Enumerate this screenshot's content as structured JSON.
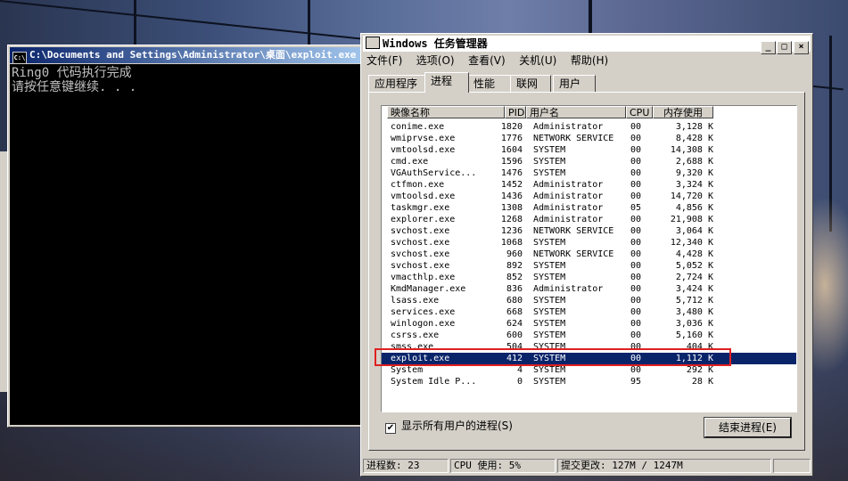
{
  "console": {
    "title": "C:\\Documents and Settings\\Administrator\\桌面\\exploit.exe",
    "icon": "console-icon",
    "lines": [
      "Ring0 代码执行完成",
      "请按任意键继续. . ."
    ]
  },
  "taskmgr": {
    "title": "Windows 任务管理器",
    "controls": {
      "minimize": "_",
      "maximize": "□",
      "close": "×"
    },
    "menu": [
      "文件(F)",
      "选项(O)",
      "查看(V)",
      "关机(U)",
      "帮助(H)"
    ],
    "tabs": [
      "应用程序",
      "进程",
      "性能",
      "联网",
      "用户"
    ],
    "active_tab": "进程",
    "columns": [
      "映像名称",
      "PID",
      "用户名",
      "CPU",
      "内存使用"
    ],
    "processes": [
      {
        "name": "conime.exe",
        "pid": "1820",
        "user": "Administrator",
        "cpu": "00",
        "mem": "3,128 K"
      },
      {
        "name": "wmiprvse.exe",
        "pid": "1776",
        "user": "NETWORK SERVICE",
        "cpu": "00",
        "mem": "8,428 K"
      },
      {
        "name": "vmtoolsd.exe",
        "pid": "1604",
        "user": "SYSTEM",
        "cpu": "00",
        "mem": "14,308 K"
      },
      {
        "name": "cmd.exe",
        "pid": "1596",
        "user": "SYSTEM",
        "cpu": "00",
        "mem": "2,688 K"
      },
      {
        "name": "VGAuthService...",
        "pid": "1476",
        "user": "SYSTEM",
        "cpu": "00",
        "mem": "9,320 K"
      },
      {
        "name": "ctfmon.exe",
        "pid": "1452",
        "user": "Administrator",
        "cpu": "00",
        "mem": "3,324 K"
      },
      {
        "name": "vmtoolsd.exe",
        "pid": "1436",
        "user": "Administrator",
        "cpu": "00",
        "mem": "14,720 K"
      },
      {
        "name": "taskmgr.exe",
        "pid": "1308",
        "user": "Administrator",
        "cpu": "05",
        "mem": "4,856 K"
      },
      {
        "name": "explorer.exe",
        "pid": "1268",
        "user": "Administrator",
        "cpu": "00",
        "mem": "21,908 K"
      },
      {
        "name": "svchost.exe",
        "pid": "1236",
        "user": "NETWORK SERVICE",
        "cpu": "00",
        "mem": "3,064 K"
      },
      {
        "name": "svchost.exe",
        "pid": "1068",
        "user": "SYSTEM",
        "cpu": "00",
        "mem": "12,340 K"
      },
      {
        "name": "svchost.exe",
        "pid": "960",
        "user": "NETWORK SERVICE",
        "cpu": "00",
        "mem": "4,428 K"
      },
      {
        "name": "svchost.exe",
        "pid": "892",
        "user": "SYSTEM",
        "cpu": "00",
        "mem": "5,052 K"
      },
      {
        "name": "vmacthlp.exe",
        "pid": "852",
        "user": "SYSTEM",
        "cpu": "00",
        "mem": "2,724 K"
      },
      {
        "name": "KmdManager.exe",
        "pid": "836",
        "user": "Administrator",
        "cpu": "00",
        "mem": "3,424 K"
      },
      {
        "name": "lsass.exe",
        "pid": "680",
        "user": "SYSTEM",
        "cpu": "00",
        "mem": "5,712 K"
      },
      {
        "name": "services.exe",
        "pid": "668",
        "user": "SYSTEM",
        "cpu": "00",
        "mem": "3,480 K"
      },
      {
        "name": "winlogon.exe",
        "pid": "624",
        "user": "SYSTEM",
        "cpu": "00",
        "mem": "3,036 K"
      },
      {
        "name": "csrss.exe",
        "pid": "600",
        "user": "SYSTEM",
        "cpu": "00",
        "mem": "5,160 K"
      },
      {
        "name": "smss.exe",
        "pid": "504",
        "user": "SYSTEM",
        "cpu": "00",
        "mem": "404 K"
      },
      {
        "name": "exploit.exe",
        "pid": "412",
        "user": "SYSTEM",
        "cpu": "00",
        "mem": "1,112 K",
        "selected": true
      },
      {
        "name": "System",
        "pid": "4",
        "user": "SYSTEM",
        "cpu": "00",
        "mem": "292 K"
      },
      {
        "name": "System Idle P...",
        "pid": "0",
        "user": "SYSTEM",
        "cpu": "95",
        "mem": "28 K"
      }
    ],
    "show_all_label": "显示所有用户的进程(S)",
    "show_all_checked": "✔",
    "end_process_label": "结束进程(E)",
    "status": {
      "processes": "进程数: 23",
      "cpu": "CPU 使用: 5%",
      "commit": "提交更改: 127M / 1247M"
    }
  },
  "colors": {
    "selection": "#0a246a",
    "highlight_box": "#e02020"
  }
}
